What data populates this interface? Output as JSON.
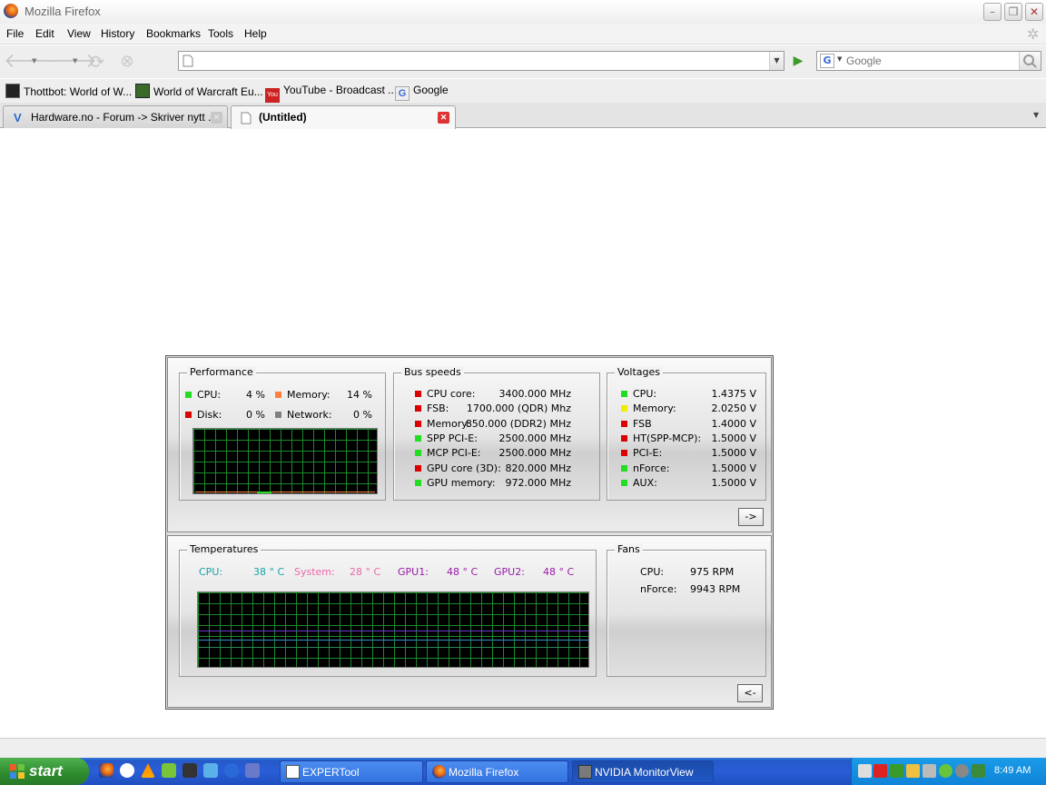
{
  "window": {
    "title": "Mozilla Firefox"
  },
  "menu": [
    "File",
    "Edit",
    "View",
    "History",
    "Bookmarks",
    "Tools",
    "Help"
  ],
  "navbar": {
    "url_value": "",
    "search_placeholder": "Google"
  },
  "bookmarks": [
    {
      "label": "Thottbot: World of W...",
      "icon": "thottbot-icon"
    },
    {
      "label": "World of Warcraft Eu...",
      "icon": "wow-icon"
    },
    {
      "label": "YouTube - Broadcast ...",
      "icon": "youtube-icon"
    },
    {
      "label": "Google",
      "icon": "google-icon"
    }
  ],
  "tabs": [
    {
      "label": "Hardware.no - Forum -> Skriver nytt ...",
      "active": false
    },
    {
      "label": "(Untitled)",
      "active": true
    }
  ],
  "monitor": {
    "performance": {
      "title": "Performance",
      "items": [
        {
          "label": "CPU:",
          "value": "4 %",
          "color": "#22dd22"
        },
        {
          "label": "Memory:",
          "value": "14 %",
          "color": "#ff8040"
        },
        {
          "label": "Disk:",
          "value": "0 %",
          "color": "#dd0000"
        },
        {
          "label": "Network:",
          "value": "0 %",
          "color": "#808080"
        }
      ]
    },
    "bus": {
      "title": "Bus speeds",
      "items": [
        {
          "label": "CPU core:",
          "value": "3400.000 MHz",
          "color": "#dd0000"
        },
        {
          "label": "FSB:",
          "value": "1700.000 (QDR) Mhz",
          "color": "#dd0000"
        },
        {
          "label": "Memory:",
          "value": "850.000  (DDR2) MHz",
          "color": "#dd0000"
        },
        {
          "label": "SPP PCI-E:",
          "value": "2500.000 MHz",
          "color": "#22dd22"
        },
        {
          "label": "MCP PCI-E:",
          "value": "2500.000 MHz",
          "color": "#22dd22"
        },
        {
          "label": "GPU core (3D):",
          "value": "820.000 MHz",
          "color": "#dd0000"
        },
        {
          "label": "GPU memory:",
          "value": "972.000 MHz",
          "color": "#22dd22"
        }
      ]
    },
    "voltages": {
      "title": "Voltages",
      "items": [
        {
          "label": "CPU:",
          "value": "1.4375 V",
          "color": "#22dd22"
        },
        {
          "label": "Memory:",
          "value": "2.0250 V",
          "color": "#eeee00"
        },
        {
          "label": "FSB",
          "value": "1.4000 V",
          "color": "#dd0000"
        },
        {
          "label": "HT(SPP-MCP):",
          "value": "1.5000 V",
          "color": "#dd0000"
        },
        {
          "label": "PCI-E:",
          "value": "1.5000 V",
          "color": "#dd0000"
        },
        {
          "label": "nForce:",
          "value": "1.5000 V",
          "color": "#22dd22"
        },
        {
          "label": "AUX:",
          "value": "1.5000 V",
          "color": "#22dd22"
        }
      ]
    },
    "expand_label": "->",
    "temperatures": {
      "title": "Temperatures",
      "items": [
        {
          "label": "CPU:",
          "value": "38 ° C",
          "color": "#1aa0a8"
        },
        {
          "label": "System:",
          "value": "28 ° C",
          "color": "#ee66aa"
        },
        {
          "label": "GPU1:",
          "value": "48 ° C",
          "color": "#9a1aa8"
        },
        {
          "label": "GPU2:",
          "value": "48 ° C",
          "color": "#9a1aa8"
        }
      ]
    },
    "fans": {
      "title": "Fans",
      "items": [
        {
          "label": "CPU:",
          "value": "975 RPM"
        },
        {
          "label": "nForce:",
          "value": "9943 RPM"
        }
      ]
    },
    "collapse_label": "<-"
  },
  "taskbar": {
    "start_label": "start",
    "tasks": [
      {
        "label": "EXPERTool",
        "active": false
      },
      {
        "label": "Mozilla Firefox",
        "active": false
      },
      {
        "label": "NVIDIA MonitorView",
        "active": true
      }
    ],
    "clock": "8:49 AM"
  }
}
